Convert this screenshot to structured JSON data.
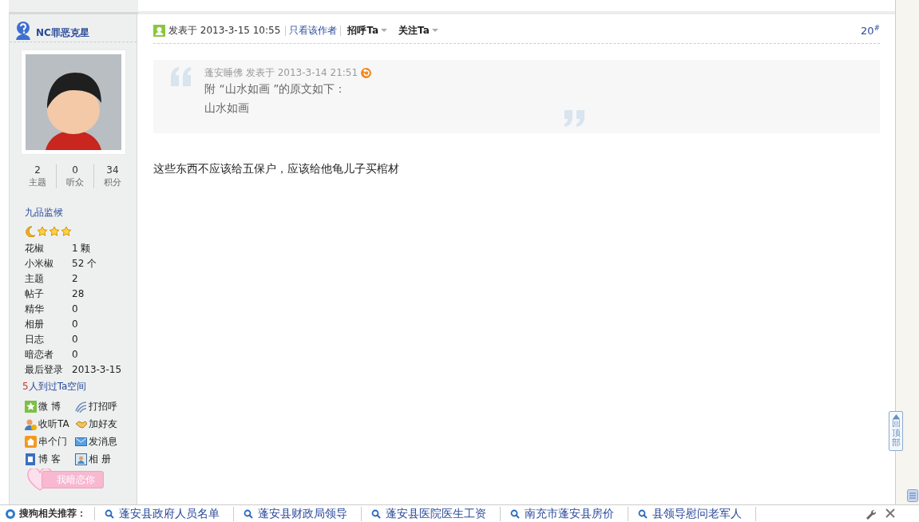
{
  "author": {
    "name": "NC罪恶克星",
    "stats": [
      {
        "value": "2",
        "label": "主题"
      },
      {
        "value": "0",
        "label": "听众"
      },
      {
        "value": "34",
        "label": "积分"
      }
    ],
    "rank": "九品监候",
    "profile": [
      {
        "label": "花椒",
        "value": "1 颗"
      },
      {
        "label": "小米椒",
        "value": "52 个"
      },
      {
        "label": "主题",
        "value": "2"
      },
      {
        "label": "帖子",
        "value": "28"
      },
      {
        "label": "精华",
        "value": "0"
      },
      {
        "label": "相册",
        "value": "0"
      },
      {
        "label": "日志",
        "value": "0"
      },
      {
        "label": "暗恋者",
        "value": "0"
      },
      {
        "label": "最后登录",
        "value": "2013-3-15"
      }
    ],
    "visitors": {
      "count": "5",
      "text": "人到过Ta空间"
    },
    "actions": [
      {
        "kind": "weibo",
        "label": "微 博"
      },
      {
        "kind": "greet",
        "label": "打招呼"
      },
      {
        "kind": "follow",
        "label": "收听TA"
      },
      {
        "kind": "friend",
        "label": "加好友"
      },
      {
        "kind": "visit",
        "label": "串个门"
      },
      {
        "kind": "message",
        "label": "发消息"
      },
      {
        "kind": "blog",
        "label": "博 客"
      },
      {
        "kind": "album",
        "label": "相 册"
      }
    ],
    "crush_button": "我暗恋你"
  },
  "post": {
    "posted_label": "发表于",
    "time": "2013-3-15 10:55",
    "author_only": "只看该作者",
    "greet": "招呼Ta",
    "follow": "关注Ta",
    "floor": "20$^{#}$"
  },
  "quote": {
    "author": "蓬安睡佛",
    "posted_label": "发表于",
    "time": "2013-3-14 21:51",
    "lines": [
      "附 “山水如画 ”的原文如下：",
      "山水如画"
    ]
  },
  "message": "这些东西不应该给五保户，应该给他龟儿子买棺材",
  "back_to_top": "回顶部",
  "related": {
    "label": "搜狗相关推荐：",
    "links": [
      "蓬安县政府人员名单",
      "蓬安县财政局领导",
      "蓬安县医院医生工资",
      "南充市蓬安县房价",
      "县领导慰问老军人"
    ]
  }
}
